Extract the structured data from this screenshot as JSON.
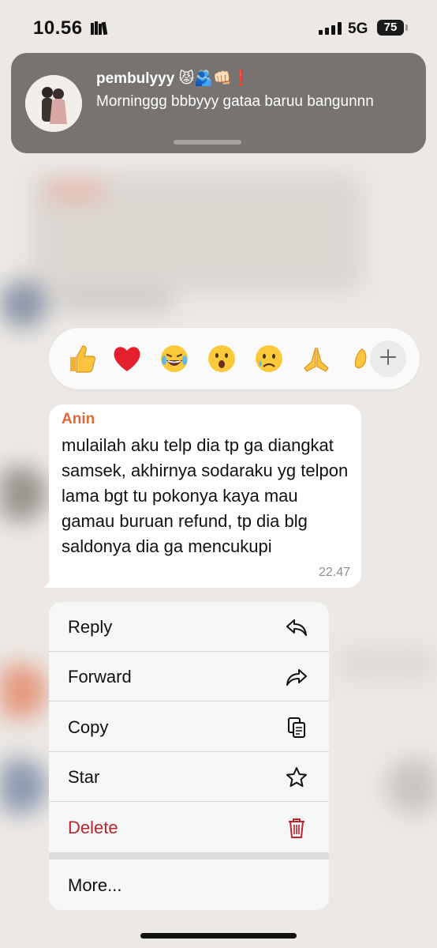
{
  "status_bar": {
    "time": "10.56",
    "network": "5G",
    "battery": "75"
  },
  "notification": {
    "title": "pembulyyy 😾🫂👊🏻❗",
    "message": "Morninggg bbbyyy gataa baruu bangunnn"
  },
  "reactions": {
    "emojis": [
      "👍",
      "❤️",
      "😂",
      "😮",
      "😢",
      "🙏",
      "👏"
    ],
    "more_icon": "plus-icon"
  },
  "message": {
    "sender": "Anin",
    "sender_color": "#e0693a",
    "text": "mulailah aku telp dia tp ga diangkat samsek, akhirnya sodaraku yg telpon lama bgt tu pokonya kaya mau gamau buruan refund, tp dia blg saldonya dia ga mencukupi",
    "time": "22.47"
  },
  "menu": {
    "reply": {
      "label": "Reply",
      "icon": "reply-icon"
    },
    "forward": {
      "label": "Forward",
      "icon": "forward-icon"
    },
    "copy": {
      "label": "Copy",
      "icon": "copy-icon"
    },
    "star": {
      "label": "Star",
      "icon": "star-icon"
    },
    "delete": {
      "label": "Delete",
      "icon": "trash-icon",
      "color": "#b8262e"
    },
    "more": {
      "label": "More..."
    }
  }
}
